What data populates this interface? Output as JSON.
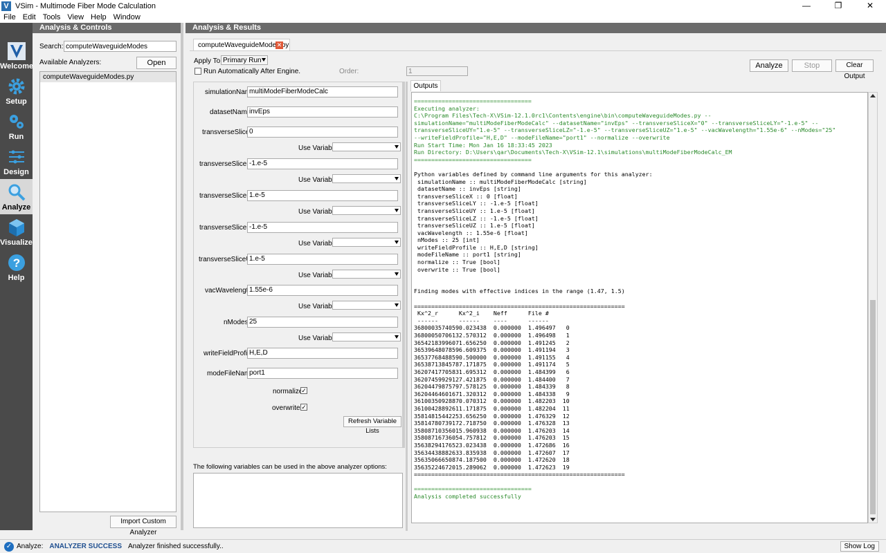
{
  "window": {
    "title": "VSim - Multimode Fiber Mode Calculation",
    "app_icon": "V",
    "minimize": "—",
    "maximize": "❐",
    "close": "✕"
  },
  "menu": [
    "File",
    "Edit",
    "Tools",
    "View",
    "Help",
    "Window"
  ],
  "sidebar": [
    {
      "label": "Welcome",
      "icon": "vsim-logo-icon"
    },
    {
      "label": "Setup",
      "icon": "gear-icon"
    },
    {
      "label": "Run",
      "icon": "gears-icon"
    },
    {
      "label": "Design",
      "icon": "design-icon"
    },
    {
      "label": "Analyze",
      "icon": "magnifier-icon"
    },
    {
      "label": "Visualize",
      "icon": "cube-icon"
    },
    {
      "label": "Help",
      "icon": "question-icon"
    }
  ],
  "left_panel": {
    "header": "Analysis & Controls",
    "search_label": "Search:",
    "search_value": "computeWaveguideModes",
    "available_label": "Available Analyzers:",
    "open_button": "Open",
    "analyzers": [
      "computeWaveguideModes.py"
    ],
    "import_button": "Import Custom Analyzer"
  },
  "right_panel": {
    "header": "Analysis & Results",
    "tab": "computeWaveguideModes.py",
    "apply_to_label": "Apply To:",
    "apply_to_value": "Primary Run",
    "run_auto_label": "Run Automatically After Engine.",
    "order_label": "Order:",
    "order_value": "1",
    "analyze_button": "Analyze",
    "stop_button": "Stop",
    "clear_button": "Clear Output",
    "outputs_tab": "Outputs",
    "use_variable_label": "Use Variable:",
    "params": [
      {
        "name": "simulationName",
        "value": "multiModeFiberModeCalc"
      },
      {
        "name": "datasetName",
        "value": "invEps"
      },
      {
        "name": "transverseSliceX",
        "value": "0"
      },
      {
        "name": "transverseSliceLY",
        "value": "-1.e-5"
      },
      {
        "name": "transverseSliceUY",
        "value": "1.e-5"
      },
      {
        "name": "transverseSliceLZ",
        "value": "-1.e-5"
      },
      {
        "name": "transverseSliceUZ",
        "value": "1.e-5"
      },
      {
        "name": "vacWavelength",
        "value": "1.55e-6"
      },
      {
        "name": "nModes",
        "value": "25"
      },
      {
        "name": "writeFieldProfile",
        "value": "H,E,D"
      },
      {
        "name": "modeFileName",
        "value": "port1"
      }
    ],
    "normalize_label": "normalize",
    "overwrite_label": "overwrite",
    "checkmark": "✓",
    "refresh_button": "Refresh Variable Lists",
    "variables_note": "The following variables can be used in the above analyzer options:",
    "output_green_1": "==================================\nExecuting analyzer:\nC:\\Program Files\\Tech-X\\VSim-12.1.0rc1\\Contents\\engine\\bin\\computeWaveguideModes.py --\nsimulationName=\"multiModeFiberModeCalc\" --datasetName=\"invEps\" --transverseSliceX=\"0\" --transverseSliceLY=\"-1.e-5\" --\ntransverseSliceUY=\"1.e-5\" --transverseSliceLZ=\"-1.e-5\" --transverseSliceUZ=\"1.e-5\" --vacWavelength=\"1.55e-6\" --nModes=\"25\"\n--writeFieldProfile=\"H,E,D\" --modeFileName=\"port1\" --normalize --overwrite\nRun Start Time: Mon Jan 16 18:33:45 2023\nRun Directory: D:\\Users\\qar\\Documents\\Tech-X\\VSim-12.1\\simulations\\multiModeFiberModeCalc_EM\n==================================",
    "output_black": "\n\nPython variables defined by command line arguments for this analyzer:\n simulationName :: multiModeFiberModeCalc [string]\n datasetName :: invEps [string]\n transverseSliceX :: 0 [float]\n transverseSliceLY :: -1.e-5 [float]\n transverseSliceUY :: 1.e-5 [float]\n transverseSliceLZ :: -1.e-5 [float]\n transverseSliceUZ :: 1.e-5 [float]\n vacWavelength :: 1.55e-6 [float]\n nModes :: 25 [int]\n writeFieldProfile :: H,E,D [string]\n modeFileName :: port1 [string]\n normalize :: True [bool]\n overwrite :: True [bool]\n\n\nFinding modes with effective indices in the range (1.47, 1.5)\n\n=============================================================\n Kx^2_r      Kx^2_i    Neff      File #\n ------      ------    ----      ------\n36800035740590.023438  0.000000  1.496497   0\n36800050706132.570312  0.000000  1.496498   1\n36542183996071.656250  0.000000  1.491245   2\n36539648078596.609375  0.000000  1.491194   3\n36537768488590.500000  0.000000  1.491155   4\n36538713845787.171875  0.000000  1.491174   5\n36207417705831.695312  0.000000  1.484399   6\n36207459929127.421875  0.000000  1.484400   7\n36204479875797.578125  0.000000  1.484339   8\n36204464601671.320312  0.000000  1.484338   9\n36100350928870.070312  0.000000  1.482203  10\n36100428892611.171875  0.000000  1.482204  11\n35814815442253.656250  0.000000  1.476329  12\n35814780739172.718750  0.000000  1.476328  13\n35808710356015.960938  0.000000  1.476203  14\n35808716736054.757812  0.000000  1.476203  15\n35638294176523.023438  0.000000  1.472686  16\n35634438882633.835938  0.000000  1.472607  17\n35635066650874.187500  0.000000  1.472620  18\n35635224672015.289062  0.000000  1.472623  19\n=============================================================\n",
    "output_green_2": "\n==================================\nAnalysis completed successfully"
  },
  "status": {
    "label": "Analyze:",
    "state": "ANALYZER SUCCESS",
    "message": "Analyzer finished successfully..",
    "show_log": "Show Log"
  }
}
